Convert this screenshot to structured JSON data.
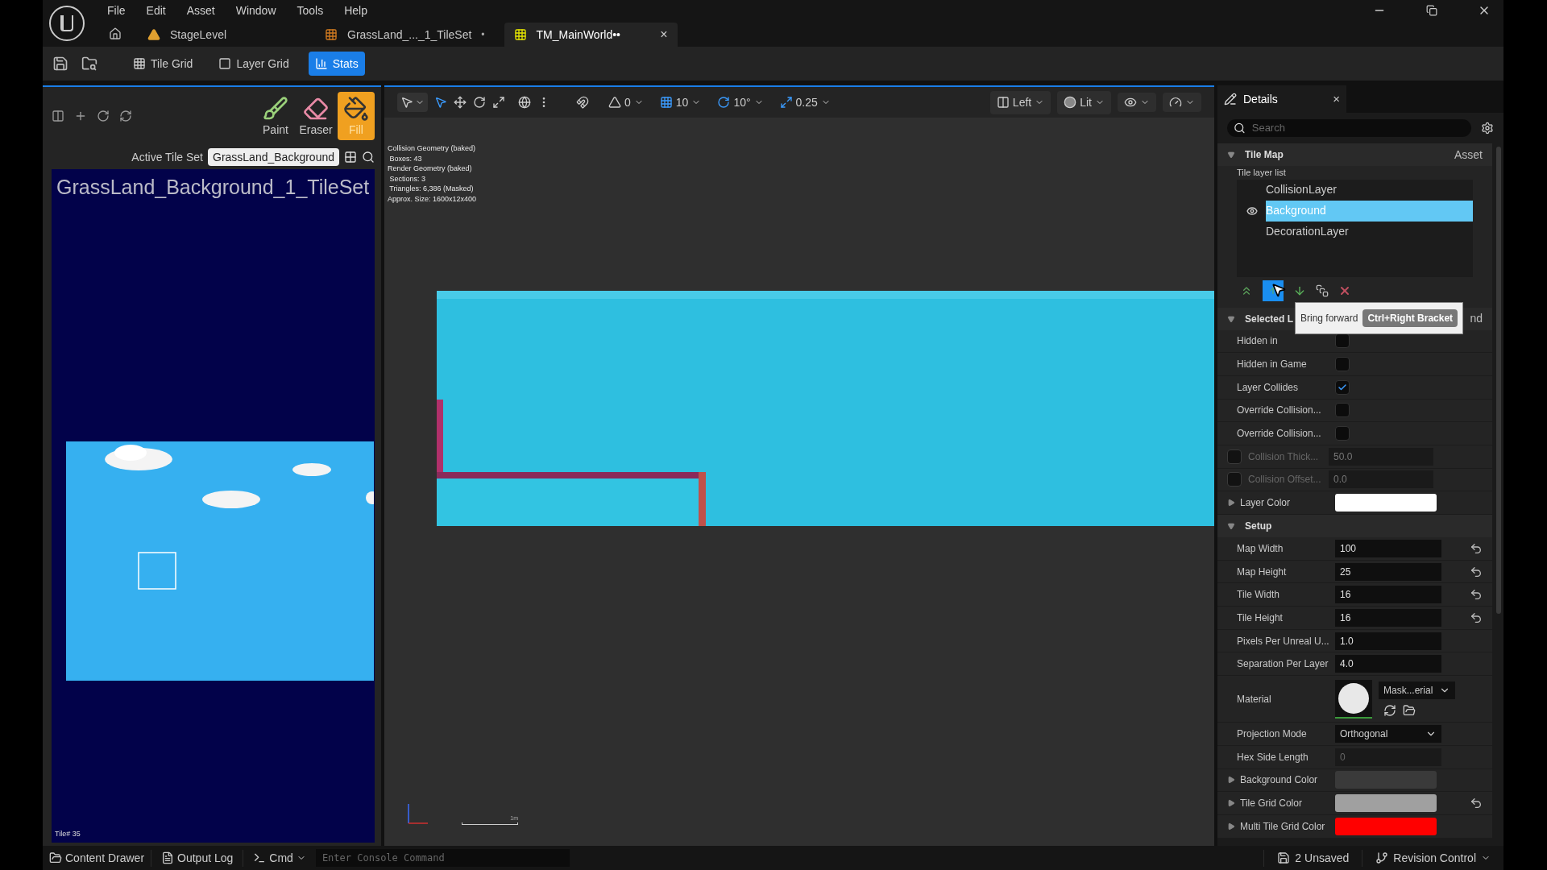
{
  "menu": [
    "File",
    "Edit",
    "Asset",
    "Window",
    "Tools",
    "Help"
  ],
  "doc_tabs": [
    {
      "label": "StageLevel",
      "kind": "level",
      "selected": false
    },
    {
      "label": "GrassLand_..._1_TileSet",
      "mark": "•",
      "kind": "tileset",
      "selected": false
    },
    {
      "label": "TM_MainWorld••",
      "kind": "tilemap",
      "selected": true,
      "close": "×"
    }
  ],
  "toolbar": [
    {
      "label": "Tile Grid",
      "kind": "grid",
      "selected": false
    },
    {
      "label": "Layer Grid",
      "kind": "layer",
      "selected": false
    },
    {
      "label": "Stats",
      "kind": "stats",
      "selected": true
    }
  ],
  "tools": [
    {
      "label": "Paint",
      "kind": "paint",
      "selected": false
    },
    {
      "label": "Eraser",
      "kind": "eraser",
      "selected": false
    },
    {
      "label": "Fill",
      "kind": "fill",
      "selected": true
    }
  ],
  "active_tile_set": {
    "label": "Active Tile Set",
    "value": "GrassLand_Background"
  },
  "tileset_title": "GrassLand_Background_1_TileSet",
  "tile_label": "Tile# 35",
  "viewport_toolbar": {
    "snaps": [
      "0",
      "10",
      "10°",
      "0.25"
    ],
    "view": "Left",
    "mode": "Lit"
  },
  "stats": [
    "Collision Geometry (baked)",
    " Boxes: 43",
    "Render Geometry (baked)",
    " Sections: 3",
    " Triangles: 6,386 (Masked)",
    "Approx. Size: 1600x12x400"
  ],
  "scale_label": "1m",
  "details": {
    "title": "Details",
    "close": "×",
    "search": {
      "placeholder": "Search"
    },
    "tile_map": {
      "title": "Tile Map",
      "asset": "Asset",
      "list_label": "Tile layer list",
      "layers": [
        {
          "name": "CollisionLayer",
          "selected": false,
          "visible": false
        },
        {
          "name": "Background",
          "selected": true,
          "visible": true
        },
        {
          "name": "DecorationLayer",
          "selected": false,
          "visible": false
        }
      ]
    },
    "tooltip": {
      "text": "Bring forward",
      "shortcut": "Ctrl+Right Bracket"
    },
    "selected_layer": {
      "title": "Selected L",
      "tail": "nd",
      "rows": [
        {
          "kind": "checkbox",
          "label": "Hidden in",
          "checked": false
        },
        {
          "kind": "checkbox",
          "label": "Hidden in Game",
          "checked": false
        },
        {
          "kind": "checkbox",
          "label": "Layer Collides",
          "checked": true
        },
        {
          "kind": "checkbox",
          "label": "Override Collision...",
          "checked": false
        },
        {
          "kind": "checkbox",
          "label": "Override Collision...",
          "checked": false
        },
        {
          "kind": "override",
          "label": "Collision Thick...",
          "checked": false,
          "value": "50.0"
        },
        {
          "kind": "override",
          "label": "Collision Offset...",
          "checked": false,
          "value": "0.0"
        },
        {
          "kind": "color",
          "label": "Layer Color",
          "color": "#ffffff"
        }
      ]
    },
    "setup": {
      "title": "Setup",
      "rows": [
        {
          "kind": "number",
          "label": "Map Width",
          "value": "100",
          "reset": true
        },
        {
          "kind": "number",
          "label": "Map Height",
          "value": "25",
          "reset": true
        },
        {
          "kind": "number",
          "label": "Tile Width",
          "value": "16",
          "reset": true
        },
        {
          "kind": "number",
          "label": "Tile Height",
          "value": "16",
          "reset": true
        },
        {
          "kind": "number",
          "label": "Pixels Per Unreal U...",
          "value": "1.0",
          "reset": false
        },
        {
          "kind": "number",
          "label": "Separation Per Layer",
          "value": "4.0",
          "reset": false
        },
        {
          "kind": "material",
          "label": "Material",
          "value": "Mask...erial"
        },
        {
          "kind": "dropdown",
          "label": "Projection Mode",
          "value": "Orthogonal"
        },
        {
          "kind": "disabled",
          "label": "Hex Side Length",
          "value": "0"
        },
        {
          "kind": "color",
          "label": "Background Color",
          "color": "#3a3a3a",
          "reset": false
        },
        {
          "kind": "color",
          "label": "Tile Grid Color",
          "color": "#a0a0a0",
          "reset": true
        },
        {
          "kind": "color",
          "label": "Multi Tile Grid Color",
          "color": "#ff0000",
          "reset": false
        }
      ]
    }
  },
  "status_bar": {
    "content_drawer": "Content Drawer",
    "output_log": "Output Log",
    "cmd": "Cmd",
    "console": {
      "placeholder": "Enter Console Command"
    },
    "unsaved": "2 Unsaved",
    "revision": "Revision Control"
  }
}
